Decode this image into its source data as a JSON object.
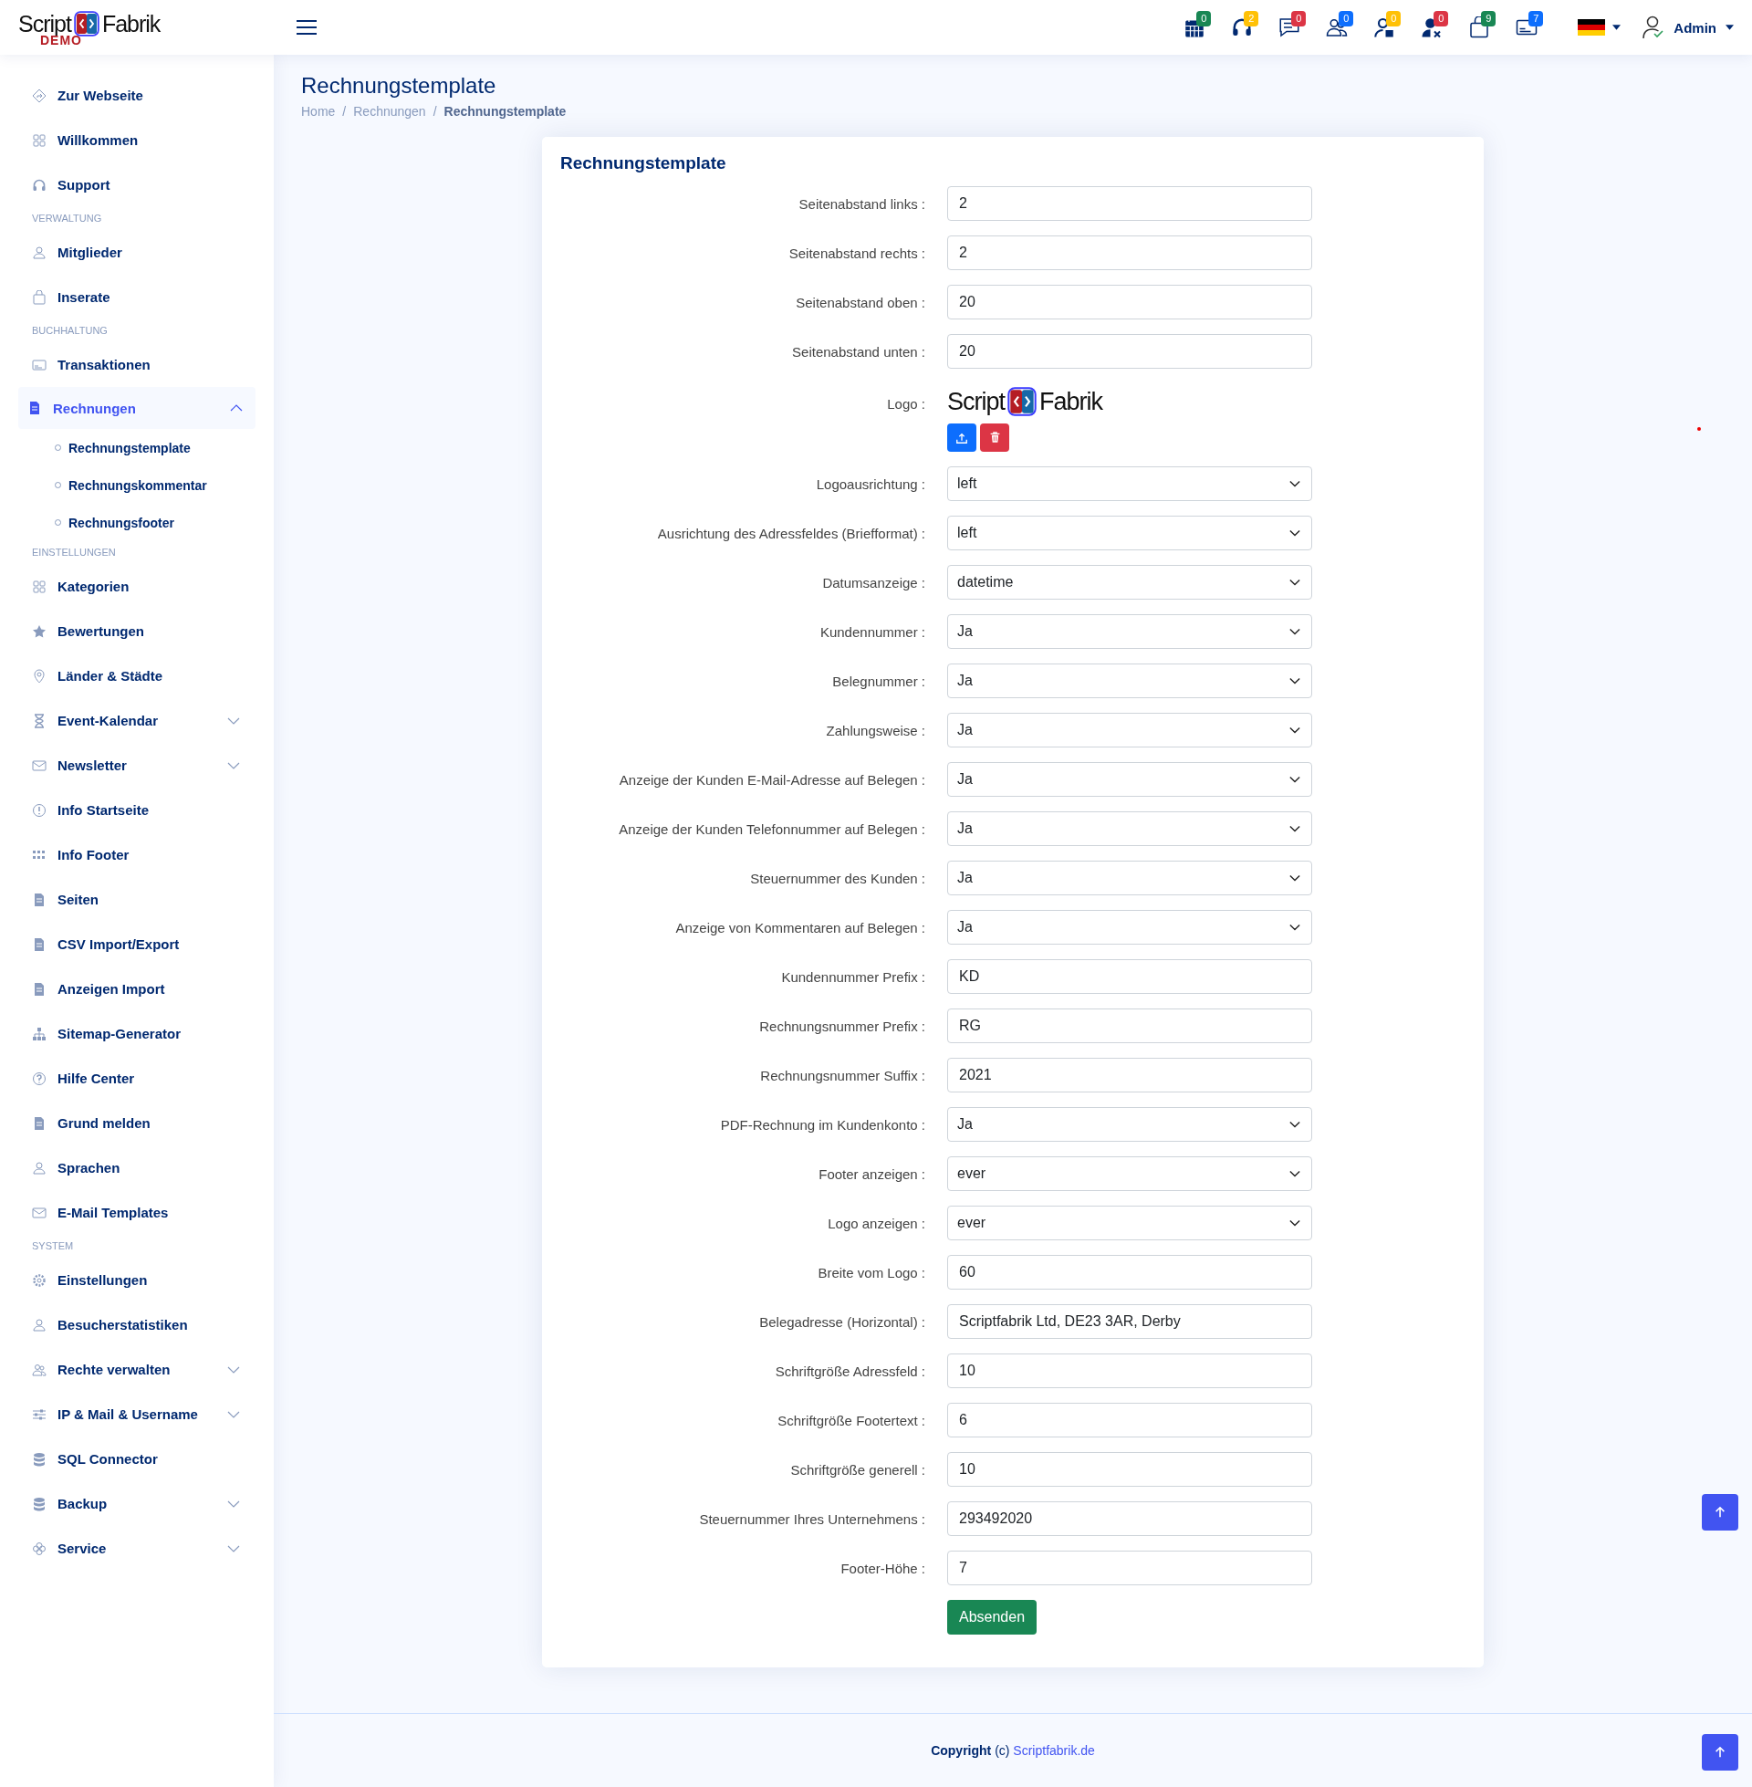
{
  "header": {
    "logo": {
      "left": "Script",
      "right": "Fabrik",
      "badge": "DEMO"
    },
    "notifications": [
      {
        "count": "0",
        "color": "#198754"
      },
      {
        "count": "2",
        "color": "#ffc107"
      },
      {
        "count": "0",
        "color": "#dc3545"
      },
      {
        "count": "0",
        "color": "#0d6efd"
      },
      {
        "count": "0",
        "color": "#ffc107"
      },
      {
        "count": "0",
        "color": "#dc3545"
      },
      {
        "count": "9",
        "color": "#198754"
      },
      {
        "count": "7",
        "color": "#0d6efd"
      }
    ],
    "user": "Admin"
  },
  "sidebar": {
    "items": [
      {
        "kind": "link",
        "label": "Zur Webseite",
        "selected": false
      },
      {
        "kind": "link",
        "label": "Willkommen",
        "selected": false
      },
      {
        "kind": "link",
        "label": "Support",
        "selected": false
      },
      {
        "kind": "section",
        "label": "VERWALTUNG"
      },
      {
        "kind": "link",
        "label": "Mitglieder",
        "selected": false
      },
      {
        "kind": "link",
        "label": "Inserate",
        "selected": false
      },
      {
        "kind": "section",
        "label": "BUCHHALTUNG"
      },
      {
        "kind": "link",
        "label": "Transaktionen",
        "selected": false
      },
      {
        "kind": "group",
        "label": "Rechnungen",
        "selected": true,
        "expanded": true,
        "children": [
          {
            "label": "Rechnungstemplate",
            "selected": false
          },
          {
            "label": "Rechnungskommentar",
            "selected": false
          },
          {
            "label": "Rechnungsfooter",
            "selected": false
          }
        ]
      },
      {
        "kind": "section",
        "label": "EINSTELLUNGEN"
      },
      {
        "kind": "link",
        "label": "Kategorien",
        "selected": false
      },
      {
        "kind": "link",
        "label": "Bewertungen",
        "selected": false
      },
      {
        "kind": "link",
        "label": "Länder & Städte",
        "selected": false
      },
      {
        "kind": "group",
        "label": "Event-Kalendar",
        "selected": false,
        "expanded": false
      },
      {
        "kind": "group",
        "label": "Newsletter",
        "selected": false,
        "expanded": false
      },
      {
        "kind": "link",
        "label": "Info Startseite",
        "selected": false
      },
      {
        "kind": "link",
        "label": "Info Footer",
        "selected": false
      },
      {
        "kind": "link",
        "label": "Seiten",
        "selected": false
      },
      {
        "kind": "link",
        "label": "CSV Import/Export",
        "selected": false
      },
      {
        "kind": "link",
        "label": "Anzeigen Import",
        "selected": false
      },
      {
        "kind": "link",
        "label": "Sitemap-Generator",
        "selected": false
      },
      {
        "kind": "link",
        "label": "Hilfe Center",
        "selected": false
      },
      {
        "kind": "link",
        "label": "Grund melden",
        "selected": false
      },
      {
        "kind": "link",
        "label": "Sprachen",
        "selected": false
      },
      {
        "kind": "link",
        "label": "E-Mail Templates",
        "selected": false
      },
      {
        "kind": "section",
        "label": "SYSTEM"
      },
      {
        "kind": "link",
        "label": "Einstellungen",
        "selected": false
      },
      {
        "kind": "link",
        "label": "Besucherstatistiken",
        "selected": false
      },
      {
        "kind": "group",
        "label": "Rechte verwalten",
        "selected": false,
        "expanded": false
      },
      {
        "kind": "group",
        "label": "IP & Mail & Username",
        "selected": false,
        "expanded": false
      },
      {
        "kind": "link",
        "label": "SQL Connector",
        "selected": false
      },
      {
        "kind": "group",
        "label": "Backup",
        "selected": false,
        "expanded": false
      },
      {
        "kind": "group",
        "label": "Service",
        "selected": false,
        "expanded": false
      }
    ]
  },
  "page": {
    "title": "Rechnungstemplate",
    "breadcrumb": [
      "Home",
      "Rechnungen",
      "Rechnungstemplate"
    ],
    "separator": "/"
  },
  "form": {
    "title": "Rechnungstemplate",
    "fields": [
      {
        "kind": "input",
        "label": "Seitenabstand links :",
        "value": "2"
      },
      {
        "kind": "input",
        "label": "Seitenabstand rechts :",
        "value": "2"
      },
      {
        "kind": "input",
        "label": "Seitenabstand oben :",
        "value": "20"
      },
      {
        "kind": "input",
        "label": "Seitenabstand unten :",
        "value": "20"
      },
      {
        "kind": "logo",
        "label": "Logo :",
        "left": "Script",
        "right": "Fabrik"
      },
      {
        "kind": "select",
        "label": "Logoausrichtung :",
        "value": "left"
      },
      {
        "kind": "select",
        "label": "Ausrichtung des Adressfeldes (Briefformat) :",
        "value": "left"
      },
      {
        "kind": "select",
        "label": "Datumsanzeige :",
        "value": "datetime"
      },
      {
        "kind": "select",
        "label": "Kundennummer :",
        "value": "Ja"
      },
      {
        "kind": "select",
        "label": "Belegnummer :",
        "value": "Ja"
      },
      {
        "kind": "select",
        "label": "Zahlungsweise :",
        "value": "Ja"
      },
      {
        "kind": "select",
        "label": "Anzeige der Kunden E-Mail-Adresse auf Belegen :",
        "value": "Ja"
      },
      {
        "kind": "select",
        "label": "Anzeige der Kunden Telefonnummer auf Belegen :",
        "value": "Ja"
      },
      {
        "kind": "select",
        "label": "Steuernummer des Kunden :",
        "value": "Ja"
      },
      {
        "kind": "select",
        "label": "Anzeige von Kommentaren auf Belegen :",
        "value": "Ja"
      },
      {
        "kind": "input",
        "label": "Kundennummer Prefix :",
        "value": "KD"
      },
      {
        "kind": "input",
        "label": "Rechnungsnummer Prefix :",
        "value": "RG"
      },
      {
        "kind": "input",
        "label": "Rechnungsnummer Suffix :",
        "value": "2021"
      },
      {
        "kind": "select",
        "label": "PDF-Rechnung im Kundenkonto :",
        "value": "Ja"
      },
      {
        "kind": "select",
        "label": "Footer anzeigen :",
        "value": "ever"
      },
      {
        "kind": "select",
        "label": "Logo anzeigen :",
        "value": "ever"
      },
      {
        "kind": "input",
        "label": "Breite vom Logo :",
        "value": "60"
      },
      {
        "kind": "input",
        "label": "Belegadresse (Horizontal) :",
        "value": "Scriptfabrik Ltd, DE23 3AR, Derby"
      },
      {
        "kind": "input",
        "label": "Schriftgröße Adressfeld :",
        "value": "10"
      },
      {
        "kind": "input",
        "label": "Schriftgröße Footertext :",
        "value": "6"
      },
      {
        "kind": "input",
        "label": "Schriftgröße generell :",
        "value": "10"
      },
      {
        "kind": "input",
        "label": "Steuernummer Ihres Unternehmens :",
        "value": "293492020"
      },
      {
        "kind": "input",
        "label": "Footer-Höhe :",
        "value": "7"
      }
    ],
    "submit": "Absenden"
  },
  "footer": {
    "label": "Copyright",
    "middle": "(c)",
    "link": "Scriptfabrik.de"
  }
}
